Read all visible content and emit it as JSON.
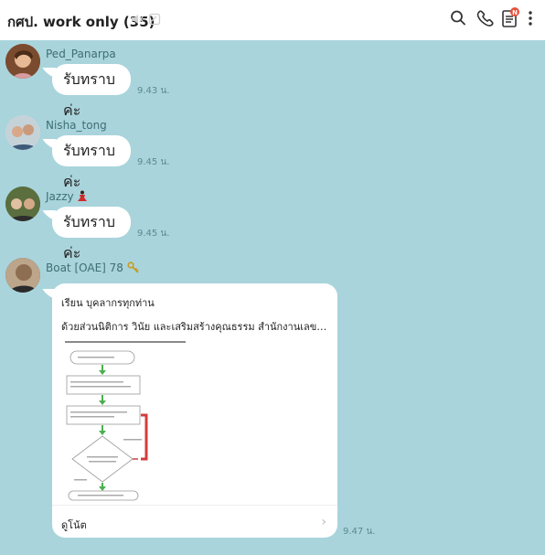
{
  "header": {
    "title": "กศป. work only (35)",
    "icons": [
      "mute-icon",
      "note-icon",
      "search-icon",
      "phone-icon",
      "notes-icon",
      "more-icon"
    ],
    "badge_color": "#e8503a"
  },
  "messages": [
    {
      "sender": "Ped_Panarpa",
      "text": "รับทราบค่ะ",
      "time": "9.43 น."
    },
    {
      "sender": "Nisha_tong",
      "text": "รับทราบค่ะ",
      "time": "9.45 น."
    },
    {
      "sender": "Jazzy",
      "text": "รับทราบค่ะ",
      "time": "9.45 น."
    },
    {
      "sender": "Boat [OAE] 78"
    }
  ],
  "card": {
    "line1": "เรียน บุคลากรทุกท่าน",
    "line2": "ด้วยส่วนนิติการ วินัย และเสริมสร้างคุณธรรม สำนักงานเลขานุการกรม...",
    "footer_label": "ดูโน้ต",
    "time": "9.47 น."
  },
  "colors": {
    "background": "#a9d4dc",
    "accent_red": "#d33c3c",
    "arrow_green": "#4caf50"
  }
}
